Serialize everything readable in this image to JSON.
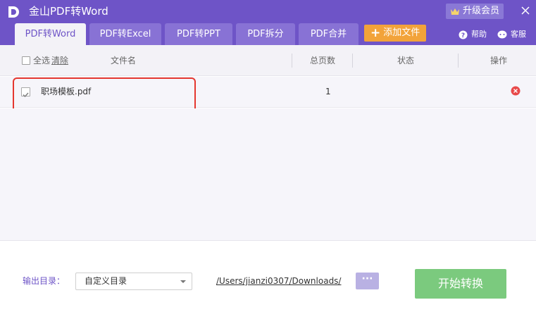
{
  "window": {
    "title": "金山PDF转Word",
    "vip_label": "升级会员"
  },
  "tabs": [
    {
      "label": "PDF转Word",
      "active": true
    },
    {
      "label": "PDF转Excel",
      "active": false
    },
    {
      "label": "PDF转PPT",
      "active": false
    },
    {
      "label": "PDF拆分",
      "active": false
    },
    {
      "label": "PDF合并",
      "active": false
    }
  ],
  "toolbar": {
    "add_file_label": "添加文件",
    "help_label": "帮助",
    "service_label": "客服"
  },
  "list": {
    "headers": {
      "select_all": "全选",
      "clear": "清除",
      "filename": "文件名",
      "pages": "总页数",
      "status": "状态",
      "action": "操作"
    },
    "rows": [
      {
        "name": "职场模板.pdf",
        "pages": "1",
        "status": "",
        "checked": true
      }
    ]
  },
  "output": {
    "label": "输出目录：",
    "select_value": "自定义目录",
    "path": "/Users/jianzi0307/Downloads/",
    "browse_label": "···"
  },
  "actions": {
    "start_label": "开始转换"
  },
  "colors": {
    "brand": "#6e54c7",
    "tab_inactive": "#8872d5",
    "add_file": "#f2a33a",
    "start": "#7bca7e",
    "highlight": "#e5372f",
    "delete": "#e8494a"
  },
  "icons": {
    "logo": "app-logo-icon",
    "vip": "crown-icon",
    "close": "close-icon",
    "help": "help-icon",
    "service": "chat-icon",
    "delete": "delete-icon",
    "check": "check-icon",
    "dropdown": "chevron-down-icon"
  }
}
